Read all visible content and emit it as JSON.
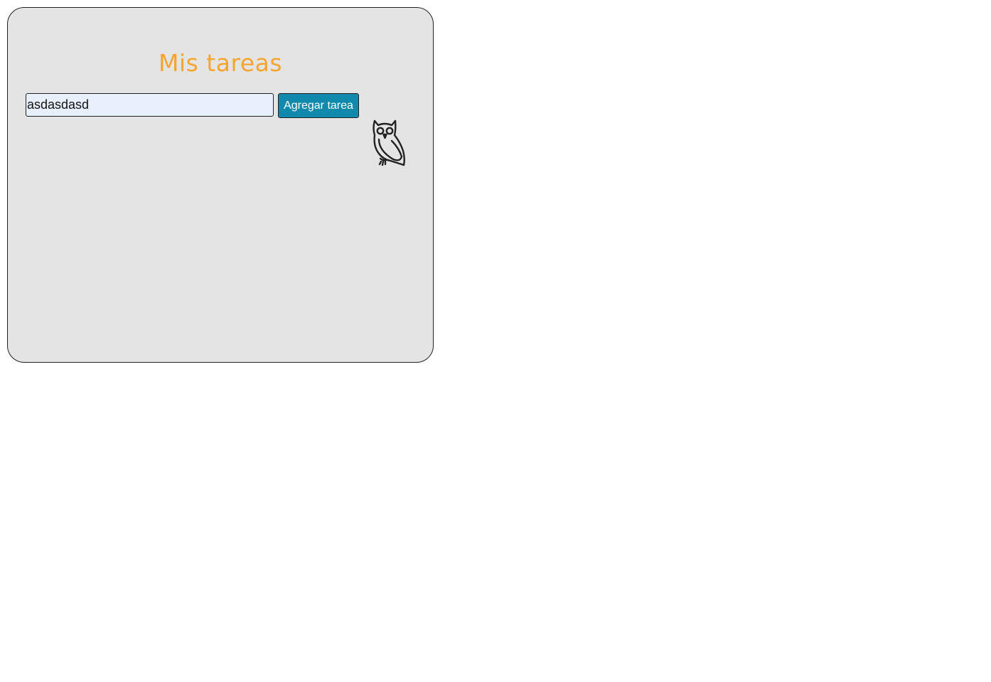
{
  "app": {
    "title": "Mis tareas"
  },
  "form": {
    "input_value": "asdasdasd",
    "add_button_label": "Agregar tarea"
  },
  "icons": {
    "mascot": "owl-icon"
  },
  "colors": {
    "title": "#f5a52d",
    "button": "#1089ad",
    "card_background": "#e4e4e4",
    "input_background": "#e8f0fe"
  }
}
